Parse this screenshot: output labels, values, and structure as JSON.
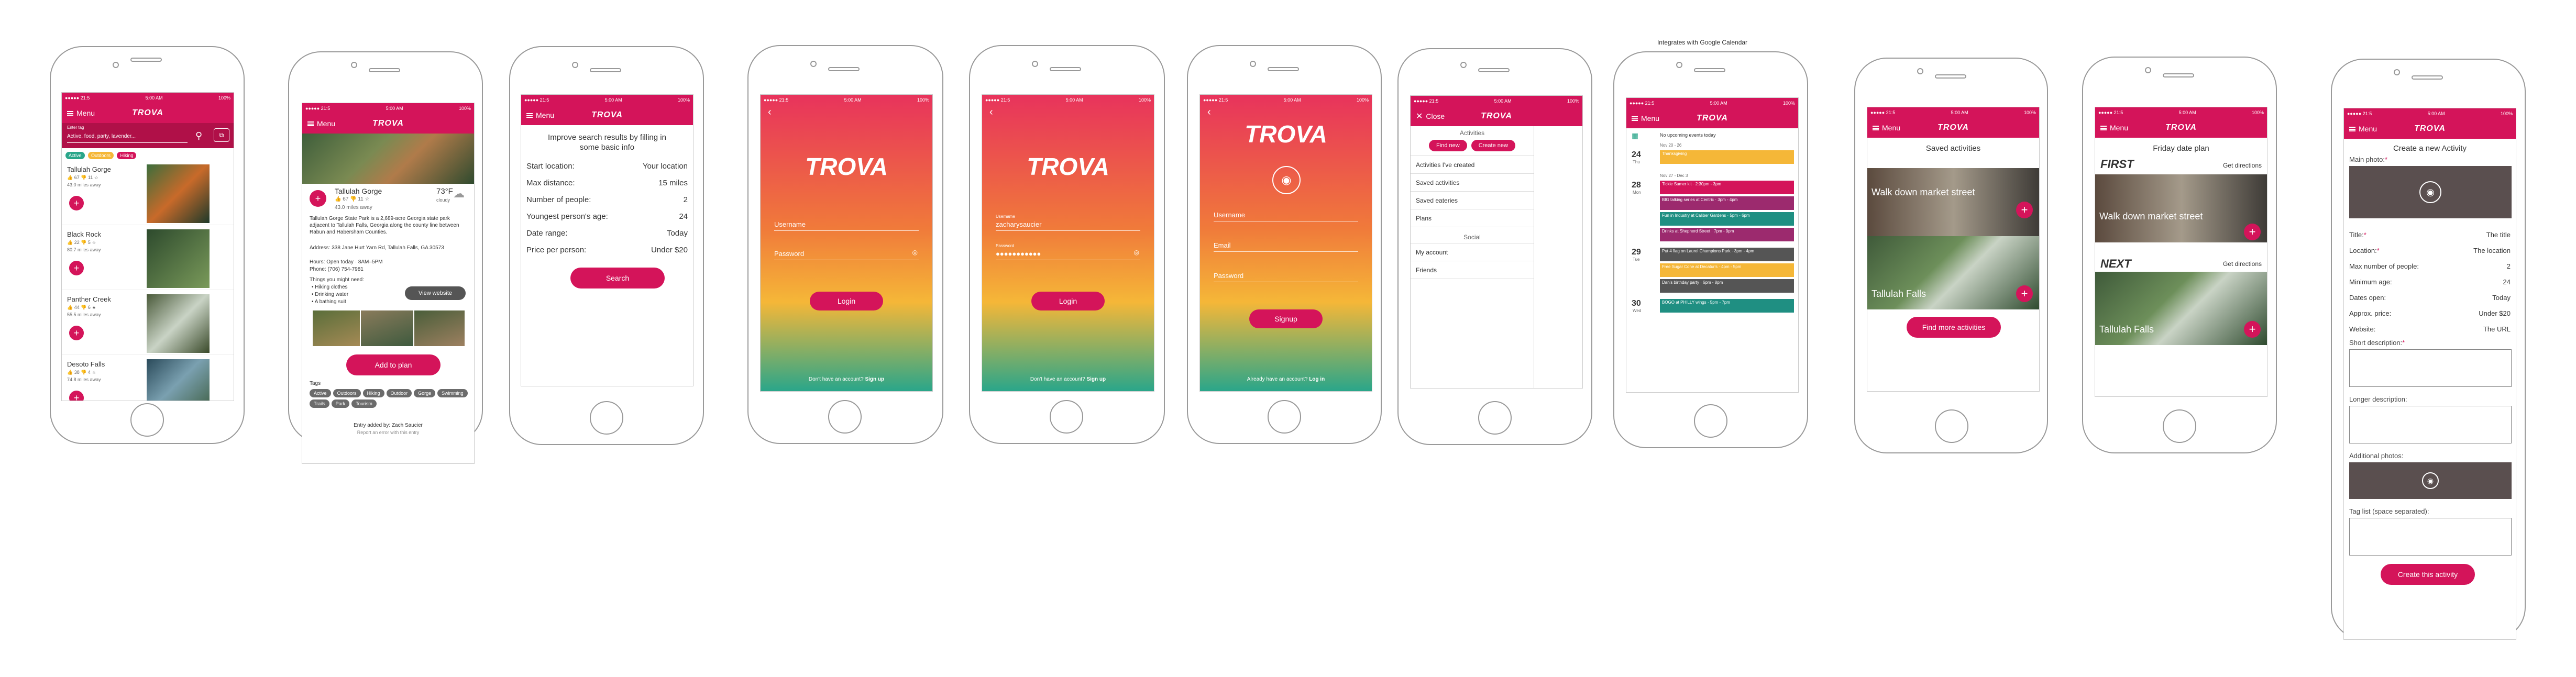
{
  "status": {
    "carrier": "●●●●● 21:5",
    "time": "5:00 AM",
    "battery": "100%"
  },
  "brand": "TROVA",
  "menu_label": "Menu",
  "close_label": "Close",
  "calendar_caption": "Integrates with Google Calendar",
  "screen1": {
    "search_hint": "Enter tag",
    "search_placeholder": "Active, food, party, lavender...",
    "chips": [
      "Active",
      "Outdoors",
      "Hiking"
    ],
    "results": [
      {
        "name": "Tallulah Gorge",
        "meta": "👍 67 👎 11 ☆",
        "dist": "43.0 miles away"
      },
      {
        "name": "Black Rock",
        "meta": "👍 22 👎 5 ☆",
        "dist": "80.7 miles away"
      },
      {
        "name": "Panther Creek",
        "meta": "👍 44 👎 6 ★",
        "dist": "55.5 miles away"
      },
      {
        "name": "Desoto Falls",
        "meta": "👍 38 👎 4 ☆",
        "dist": "74.8 miles away"
      }
    ]
  },
  "screen2": {
    "name": "Tallulah Gorge",
    "meta": "👍 67 👎 11 ☆",
    "dist": "43.0 miles away",
    "temp": "73°F",
    "weather": "cloudy",
    "desc": "Tallulah Gorge State Park is a 2,689-acre Georgia state park adjacent to Tallulah Falls, Georgia along the county line between Rabun and Habersham Counties.",
    "address": "Address: 338 Jane Hurt Yarn Rd, Tallulah Falls, GA 30573",
    "hours": "Hours: Open today · 8AM–5PM",
    "phone": "Phone: (706) 754-7981",
    "need_title": "Things you might need:",
    "need": [
      "• Hiking clothes",
      "• Drinking water",
      "• A bathing suit"
    ],
    "website_btn": "View website",
    "add_btn": "Add to plan",
    "tags_label": "Tags",
    "tags": [
      "Active",
      "Outdoors",
      "Hiking",
      "Outdoor",
      "Gorge",
      "Swimming",
      "Trails",
      "Park",
      "Tourism"
    ],
    "added_by": "Entry added by: Zach Saucier",
    "report": "Report an error with this entry"
  },
  "screen3": {
    "intro": "Improve search results by filling in some basic info",
    "rows": [
      {
        "k": "Start location:",
        "v": "Your location"
      },
      {
        "k": "Max distance:",
        "v": "15 miles"
      },
      {
        "k": "Number of people:",
        "v": "2"
      },
      {
        "k": "Youngest person's age:",
        "v": "24"
      },
      {
        "k": "Date range:",
        "v": "Today"
      },
      {
        "k": "Price per person:",
        "v": "Under $20"
      }
    ],
    "search_btn": "Search"
  },
  "login": {
    "username": "Username",
    "password": "Password",
    "btn": "Login",
    "no_account": "Don't have an account?",
    "signup_link": "Sign up",
    "filled_user": "zacharysaucier",
    "filled_pass": "●●●●●●●●●●●"
  },
  "signup": {
    "username": "Username",
    "email": "Email",
    "password": "Password",
    "btn": "Signup",
    "have_account": "Already have an account?",
    "login_link": "Log in"
  },
  "menu": {
    "activities_head": "Activities",
    "find_btn": "Find new",
    "create_btn": "Create new",
    "items": [
      "Activities I've created",
      "Saved activities",
      "Saved eateries",
      "Plans"
    ],
    "social_head": "Social",
    "social_items": [
      "My account",
      "Friends"
    ]
  },
  "calendar": {
    "no_events": "No upcoming events today",
    "weeks": [
      {
        "label": "Nov 20 - 26",
        "days": [
          {
            "num": "24",
            "dow": "Thu",
            "events": [
              {
                "t": "Thanksgiving",
                "c": "#f5b738"
              }
            ]
          }
        ]
      },
      {
        "label": "Nov 27 - Dec 3",
        "days": [
          {
            "num": "28",
            "dow": "Mon",
            "events": [
              {
                "t": "Tickle Sumer kit · 2:30pm - 3pm",
                "c": "#d4145a"
              },
              {
                "t": "BIG talking series at Centric · 3pm - 4pm",
                "c": "#9c2a6e"
              },
              {
                "t": "Fun in Industry at Caliber Gardens · 5pm - 6pm",
                "c": "#1f8f82"
              },
              {
                "t": "Drinks at Shepherd Street · 7pm - 9pm",
                "c": "#9c2a6e"
              }
            ]
          },
          {
            "num": "29",
            "dow": "Tue",
            "events": [
              {
                "t": "Put 4 flag on Laurel Champions Park · 3pm - 4pm",
                "c": "#555"
              },
              {
                "t": "Free Sugar Cone at Decatur's · 4pm - 5pm",
                "c": "#f5b738"
              },
              {
                "t": "Dan's birthday party · 6pm - 8pm",
                "c": "#555"
              }
            ]
          },
          {
            "num": "30",
            "dow": "Wed",
            "events": [
              {
                "t": "BOGO at PHILLY wings · 5pm - 7pm",
                "c": "#1f8f82"
              }
            ]
          }
        ]
      }
    ]
  },
  "saved": {
    "title": "Saved activities",
    "items": [
      "Walk down market street",
      "Tallulah Falls"
    ],
    "btn": "Find more activities"
  },
  "plan": {
    "title": "Friday date plan",
    "first": "FIRST",
    "next": "NEXT",
    "directions": "Get directions",
    "items": [
      "Walk down market street",
      "Tallulah Falls"
    ]
  },
  "create": {
    "title": "Create a new Activity",
    "main_photo": "Main photo:",
    "rows": [
      {
        "k": "Title:",
        "v": "The title"
      },
      {
        "k": "Location:",
        "v": "The location"
      },
      {
        "k": "Max number of people:",
        "v": "2"
      },
      {
        "k": "Minimum age:",
        "v": "24"
      },
      {
        "k": "Dates open:",
        "v": "Today"
      },
      {
        "k": "Approx. price:",
        "v": "Under $20"
      },
      {
        "k": "Website:",
        "v": "The URL"
      }
    ],
    "short": "Short description:",
    "longer": "Longer description:",
    "additional": "Additional photos:",
    "tags": "Tag list (space separated):",
    "btn": "Create this activity"
  }
}
